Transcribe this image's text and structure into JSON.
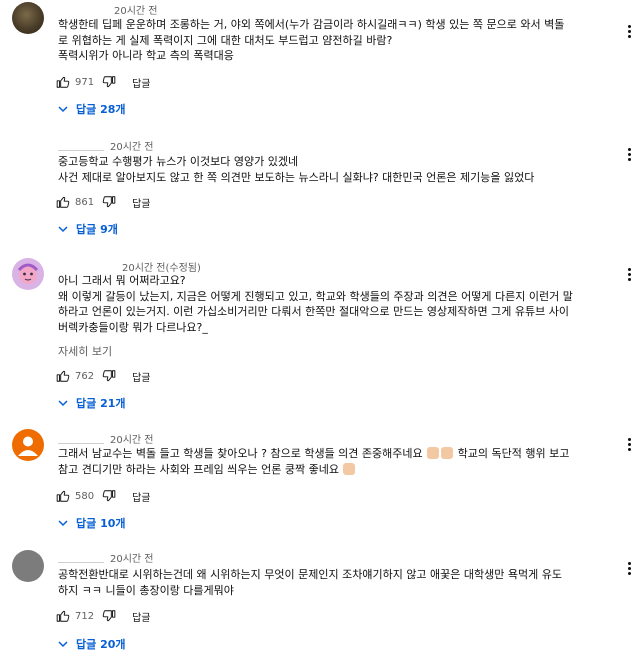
{
  "comments": [
    {
      "time": "20시간 전",
      "lines": [
        "학생한테 딥페 운운하며 조롱하는 거,  야외 쪽에서(누가 감금이라 하시길래ㅋㅋ) 학생 있는 쪽 문으로 와서 벽돌",
        "로 위협하는 게 실제 폭력이지 그에 대한 대처도 부드럽고 얌전하길 바람?",
        "폭력시위가 아니라 학교 측의 폭력대응"
      ],
      "likes": "971",
      "reply_label": "답글",
      "replies_label": "답글 28개"
    },
    {
      "time": "20시간 전",
      "lines": [
        "중고등학교 수행평가 뉴스가 이것보다 영양가 있겠네",
        "사건 제대로 알아보지도 않고 한 쪽 의견만 보도하는 뉴스라니 실화냐? 대한민국 언론은 제기능을 잃었다"
      ],
      "likes": "861",
      "reply_label": "답글",
      "replies_label": "답글 9개"
    },
    {
      "time": "20시간 전(수정됨)",
      "lines": [
        "아니 그래서 뭐 어쩌라고요?",
        "왜 이렇게 갈등이 났는지, 지금은 어떻게 진행되고 있고, 학교와 학생들의 주장과 의견은 어떻게 다른지 이런거 말",
        "하라고 언론이 있는거지. 이런 가십소비거리만 다뤄서 한쪽만 절대악으로 만드는 영상제작하면 그게 유튜브 사이",
        "버렉카충들이랑 뭐가 다르나요?_"
      ],
      "more_label": "자세히 보기",
      "likes": "762",
      "reply_label": "답글",
      "replies_label": "답글 21개"
    },
    {
      "time": "20시간 전",
      "lines": [
        "그래서 남교수는 벽돌 들고 학생들 찾아오나 ? 참으로 학생들 의견 존중해주네요",
        "참고 견디기만 하라는 사회와 프레임 씌우는 언론 쿵짝 좋네요"
      ],
      "line1_tail": "학교의 독단적 행위 보고",
      "likes": "580",
      "reply_label": "답글",
      "replies_label": "답글 10개"
    },
    {
      "time": "20시간 전",
      "lines": [
        "공학전환반대로 시위하는건데 왜 시위하는지 무엇이 문제인지 조차얘기하지 않고 애꿎은 대학생만 욕먹게 유도",
        "하지 ㅋㅋ 니들이 총장이랑 다를게뭐야"
      ],
      "likes": "712",
      "reply_label": "답글",
      "replies_label": "답글 20개"
    }
  ],
  "colors": {
    "link": "#065fd4",
    "secondary": "#606060",
    "text": "#0f0f0f"
  }
}
